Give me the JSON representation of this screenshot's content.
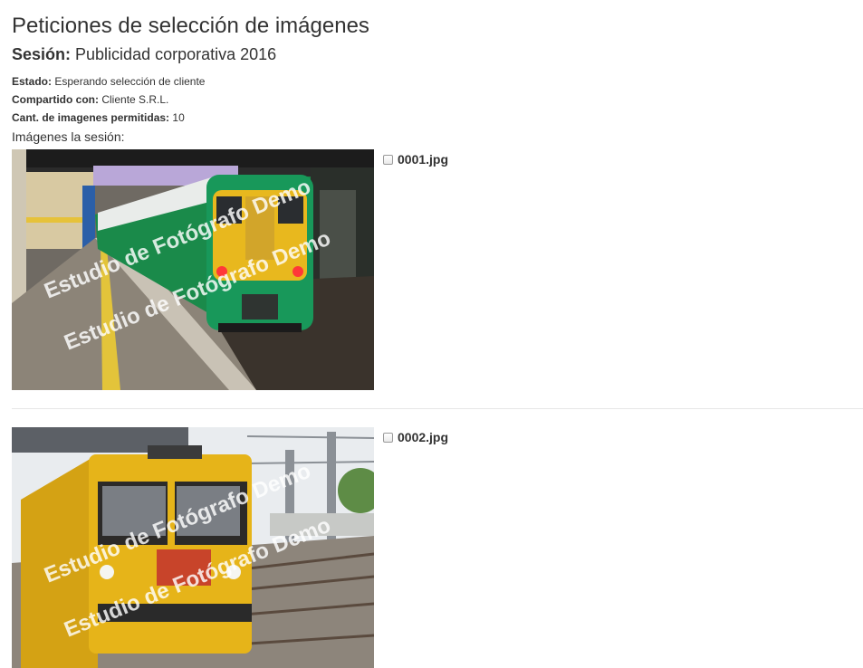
{
  "page": {
    "title": "Peticiones de selección de imágenes",
    "session_label": "Sesión:",
    "session_name": "Publicidad corporativa 2016",
    "status_label": "Estado:",
    "status_value": "Esperando selección de cliente",
    "shared_label": "Compartido con:",
    "shared_value": "Cliente S.R.L.",
    "allowed_label": "Cant. de imagenes permitidas:",
    "allowed_value": "10",
    "images_heading": "Imágenes la sesión:"
  },
  "images": [
    {
      "filename": "0001.jpg",
      "selected": false,
      "watermark": "Estudio de Fotógrafo Demo",
      "subject": "green-passenger-train"
    },
    {
      "filename": "0002.jpg",
      "selected": false,
      "watermark": "Estudio de Fotógrafo Demo",
      "subject": "yellow-maintenance-train"
    }
  ],
  "colors": {
    "text": "#333333",
    "divider": "#e6e6e6",
    "train1_body": "#1a8a4a",
    "train1_front": "#e8b81e",
    "train2_body": "#e6b419"
  }
}
